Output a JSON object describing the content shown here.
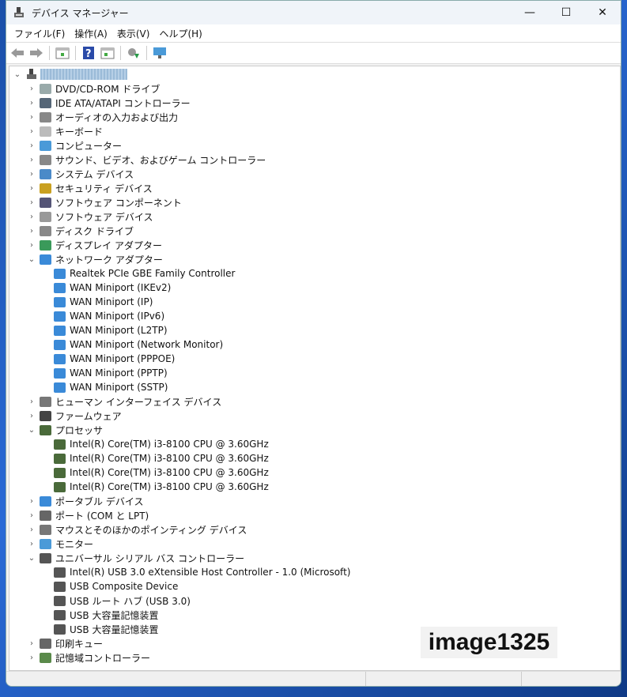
{
  "window": {
    "title": "デバイス マネージャー",
    "minimize": "—",
    "maximize": "☐",
    "close": "✕"
  },
  "menu": [
    "ファイル(F)",
    "操作(A)",
    "表示(V)",
    "ヘルプ(H)"
  ],
  "toolbar": [
    "back-icon",
    "forward-icon",
    "show-hide-console-tree-icon",
    "help-icon",
    "properties-icon",
    "update-driver-icon",
    "scan-hardware-icon"
  ],
  "tree": [
    {
      "label": "DVD/CD-ROM ドライブ",
      "depth": 1,
      "exp": false,
      "icon": "#9aa"
    },
    {
      "label": "IDE ATA/ATAPI コントローラー",
      "depth": 1,
      "exp": false,
      "icon": "#567"
    },
    {
      "label": "オーディオの入力および出力",
      "depth": 1,
      "exp": false,
      "icon": "#888"
    },
    {
      "label": "キーボード",
      "depth": 1,
      "exp": false,
      "icon": "#bbb"
    },
    {
      "label": "コンピューター",
      "depth": 1,
      "exp": false,
      "icon": "#4a9ad8"
    },
    {
      "label": "サウンド、ビデオ、およびゲーム コントローラー",
      "depth": 1,
      "exp": false,
      "icon": "#888"
    },
    {
      "label": "システム デバイス",
      "depth": 1,
      "exp": false,
      "icon": "#4a8ac8"
    },
    {
      "label": "セキュリティ デバイス",
      "depth": 1,
      "exp": false,
      "icon": "#c9a020"
    },
    {
      "label": "ソフトウェア コンポーネント",
      "depth": 1,
      "exp": false,
      "icon": "#557"
    },
    {
      "label": "ソフトウェア デバイス",
      "depth": 1,
      "exp": false,
      "icon": "#999"
    },
    {
      "label": "ディスク ドライブ",
      "depth": 1,
      "exp": false,
      "icon": "#888"
    },
    {
      "label": "ディスプレイ アダプター",
      "depth": 1,
      "exp": false,
      "icon": "#3a9a5a"
    },
    {
      "label": "ネットワーク アダプター",
      "depth": 1,
      "exp": true,
      "icon": "#3a8ad8"
    },
    {
      "label": "Realtek PCIe GBE Family Controller",
      "depth": 2,
      "icon": "#3a8ad8"
    },
    {
      "label": "WAN Miniport (IKEv2)",
      "depth": 2,
      "icon": "#3a8ad8"
    },
    {
      "label": "WAN Miniport (IP)",
      "depth": 2,
      "icon": "#3a8ad8"
    },
    {
      "label": "WAN Miniport (IPv6)",
      "depth": 2,
      "icon": "#3a8ad8"
    },
    {
      "label": "WAN Miniport (L2TP)",
      "depth": 2,
      "icon": "#3a8ad8"
    },
    {
      "label": "WAN Miniport (Network Monitor)",
      "depth": 2,
      "icon": "#3a8ad8"
    },
    {
      "label": "WAN Miniport (PPPOE)",
      "depth": 2,
      "icon": "#3a8ad8"
    },
    {
      "label": "WAN Miniport (PPTP)",
      "depth": 2,
      "icon": "#3a8ad8"
    },
    {
      "label": "WAN Miniport (SSTP)",
      "depth": 2,
      "icon": "#3a8ad8"
    },
    {
      "label": "ヒューマン インターフェイス デバイス",
      "depth": 1,
      "exp": false,
      "icon": "#777"
    },
    {
      "label": "ファームウェア",
      "depth": 1,
      "exp": false,
      "icon": "#444"
    },
    {
      "label": "プロセッサ",
      "depth": 1,
      "exp": true,
      "icon": "#4a6a3a"
    },
    {
      "label": "Intel(R) Core(TM) i3-8100 CPU @ 3.60GHz",
      "depth": 2,
      "icon": "#4a6a3a"
    },
    {
      "label": "Intel(R) Core(TM) i3-8100 CPU @ 3.60GHz",
      "depth": 2,
      "icon": "#4a6a3a"
    },
    {
      "label": "Intel(R) Core(TM) i3-8100 CPU @ 3.60GHz",
      "depth": 2,
      "icon": "#4a6a3a"
    },
    {
      "label": "Intel(R) Core(TM) i3-8100 CPU @ 3.60GHz",
      "depth": 2,
      "icon": "#4a6a3a"
    },
    {
      "label": "ポータブル デバイス",
      "depth": 1,
      "exp": false,
      "icon": "#3a8ad8"
    },
    {
      "label": "ポート (COM と LPT)",
      "depth": 1,
      "exp": false,
      "icon": "#666"
    },
    {
      "label": "マウスとそのほかのポインティング デバイス",
      "depth": 1,
      "exp": false,
      "icon": "#777"
    },
    {
      "label": "モニター",
      "depth": 1,
      "exp": false,
      "icon": "#4a9ad8"
    },
    {
      "label": "ユニバーサル シリアル バス コントローラー",
      "depth": 1,
      "exp": true,
      "icon": "#555"
    },
    {
      "label": "Intel(R) USB 3.0 eXtensible Host Controller - 1.0 (Microsoft)",
      "depth": 2,
      "icon": "#555"
    },
    {
      "label": "USB Composite Device",
      "depth": 2,
      "icon": "#555"
    },
    {
      "label": "USB ルート ハブ (USB 3.0)",
      "depth": 2,
      "icon": "#555"
    },
    {
      "label": "USB 大容量記憶装置",
      "depth": 2,
      "icon": "#555"
    },
    {
      "label": "USB 大容量記憶装置",
      "depth": 2,
      "icon": "#555"
    },
    {
      "label": "印刷キュー",
      "depth": 1,
      "exp": false,
      "icon": "#666"
    },
    {
      "label": "記憶域コントローラー",
      "depth": 1,
      "exp": false,
      "icon": "#5a8a4a"
    }
  ],
  "watermark": "image1325"
}
